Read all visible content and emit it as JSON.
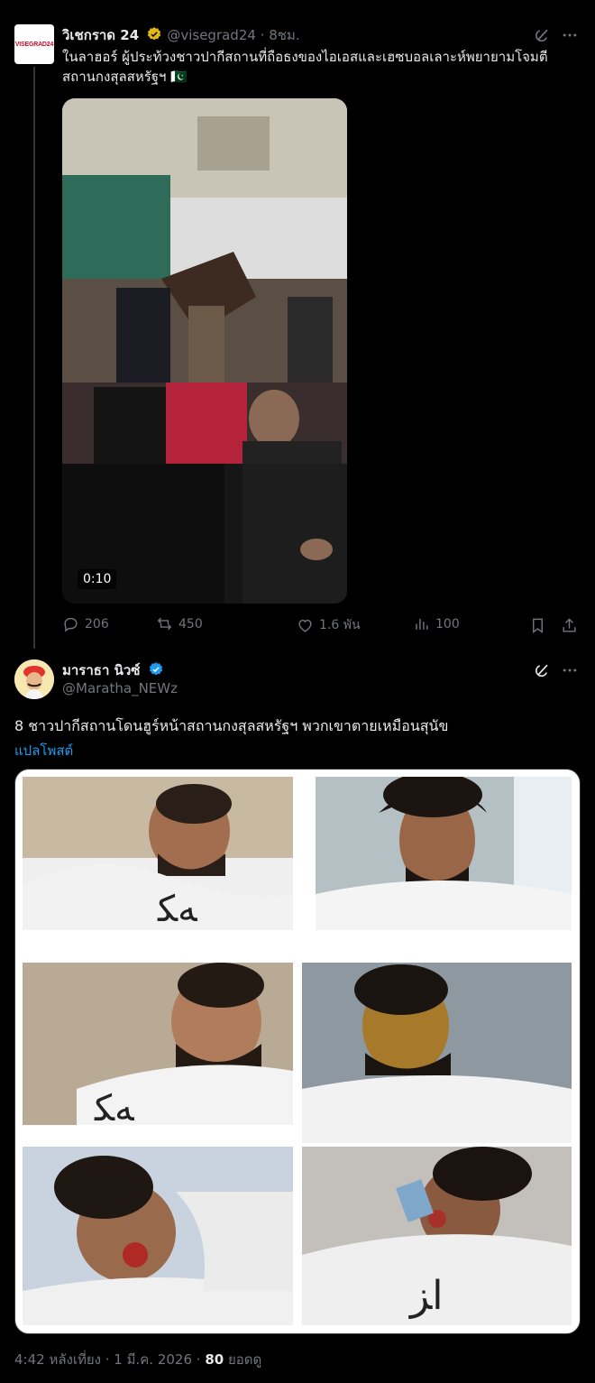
{
  "quoted": {
    "avatar_text": "VISEGRAD24",
    "name": "วิเชกราด 24",
    "handle_time": "@visegrad24 · 8ชม.",
    "text": "ในลาฮอร์ ผู้ประท้วงชาวปากีสถานที่ถือธงของไอเอสและเฮซบอลเลาะห์พยายามโจมตีสถานกงสุลสหรัฐฯ 🇵🇰",
    "video_duration": "0:10",
    "stats": {
      "replies": "206",
      "reposts": "450",
      "likes": "1.6 พัน",
      "views": "100"
    }
  },
  "main": {
    "name": "มาราธา นิวซ์",
    "handle": "@Maratha_NEWz",
    "text": "8 ชาวปากีสถานโดนฮูร์หน้าสถานกงสุลสหรัฐฯ พวกเขาตายเหมือนสุนัข",
    "translate_label": "แปลโพสต์",
    "timestamp": "4:42 หลังเที่ยง · 1 มี.ค. 2026 · ",
    "views_count": "80",
    "views_label": " ยอดดู"
  },
  "icons": [
    "grok-icon",
    "more-icon",
    "reply-icon",
    "repost-icon",
    "like-icon",
    "views-icon",
    "bookmark-icon",
    "share-icon",
    "verified-icon"
  ],
  "colors": {
    "accent": "#1d9bf0",
    "verified_gold": "#e2b719",
    "muted": "#71767b",
    "text": "#e7e9ea"
  }
}
